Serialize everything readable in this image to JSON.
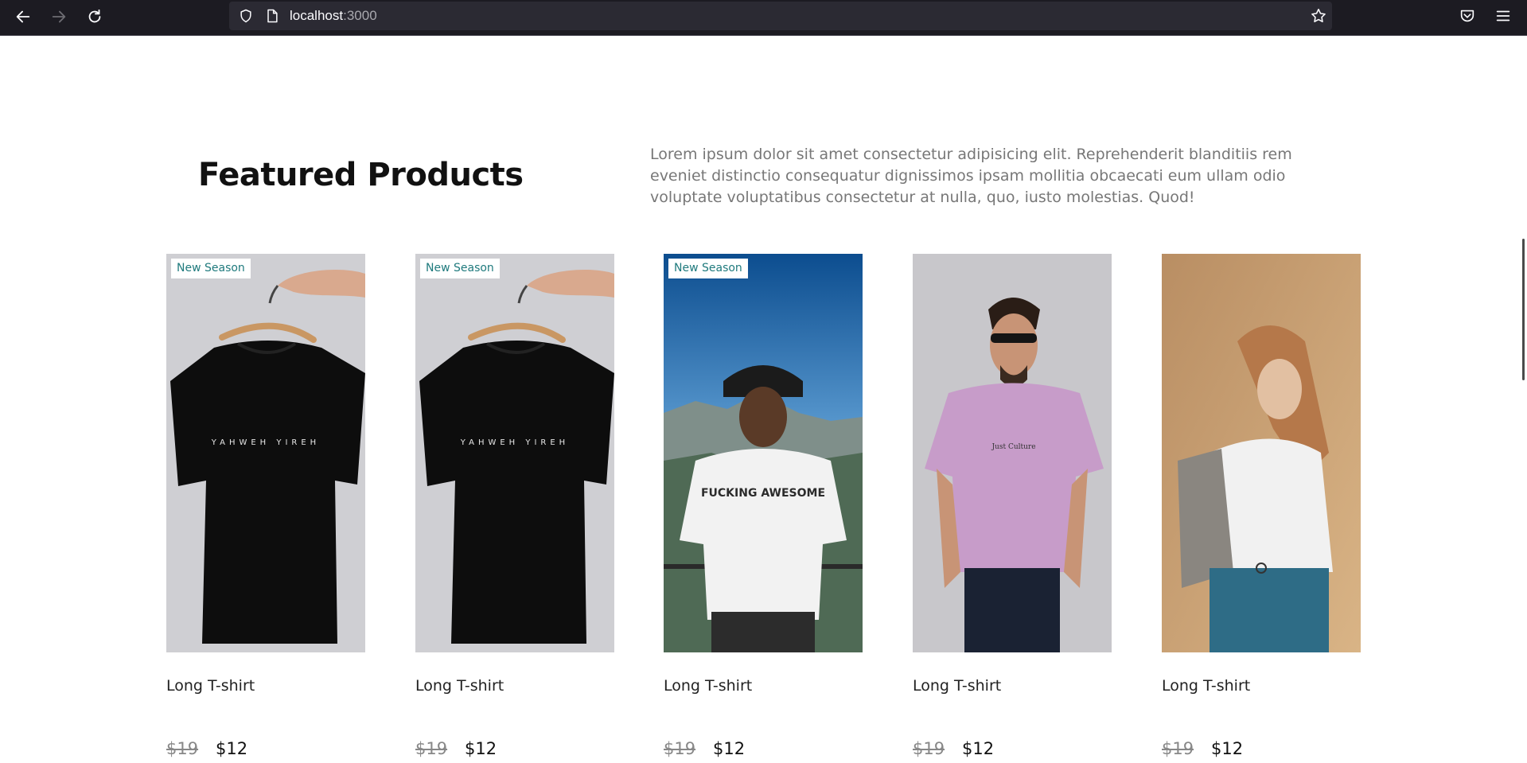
{
  "browser": {
    "url_host": "localhost",
    "url_port": ":3000",
    "icons": [
      "back-icon",
      "forward-icon",
      "reload-icon",
      "shield-icon",
      "page-icon",
      "star-icon",
      "pocket-icon",
      "menu-icon"
    ]
  },
  "section": {
    "title": "Featured Products",
    "description": "Lorem ipsum dolor sit amet consectetur adipisicing elit. Reprehenderit blanditiis rem eveniet distinctio consequatur dignissimos ipsam mollitia obcaecati eum ullam odio voluptate voluptatibus consectetur at nulla, quo, iusto molestias. Quod!"
  },
  "products": [
    {
      "badge": "New Season",
      "title": "Long T-shirt",
      "old_price": "$19",
      "price": "$12",
      "image": "black t-shirt on hanger",
      "tee_print": "YAHWEH YIREH"
    },
    {
      "badge": "New Season",
      "title": "Long T-shirt",
      "old_price": "$19",
      "price": "$12",
      "image": "black t-shirt on hanger",
      "tee_print": "YAHWEH YIREH"
    },
    {
      "badge": "New Season",
      "title": "Long T-shirt",
      "old_price": "$19",
      "price": "$12",
      "image": "man in white tee and beanie outdoors",
      "tee_print": "FUCKING AWESOME"
    },
    {
      "title": "Long T-shirt",
      "old_price": "$19",
      "price": "$12",
      "image": "man in pink tee with sunglasses",
      "tee_print": "Just Culture"
    },
    {
      "title": "Long T-shirt",
      "old_price": "$19",
      "price": "$12",
      "image": "woman in white shirt and denim"
    }
  ],
  "colors": {
    "chrome_bg": "#1c1b22",
    "urlbar_bg": "#2b2a33",
    "badge_text": "#1f7a7d",
    "muted_text": "#777777"
  }
}
